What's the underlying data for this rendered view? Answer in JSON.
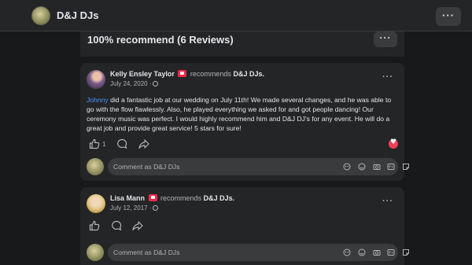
{
  "topbar": {
    "page_name": "D&J DJs",
    "more_label": "···"
  },
  "header": {
    "title": "100% recommend (6 Reviews)",
    "more_label": "···"
  },
  "reviews": [
    {
      "author": "Kelly Ensley Taylor",
      "action": "recommends",
      "page": "D&J DJs.",
      "date": "July 24, 2020 ·",
      "mention": "Johnny",
      "text": " did a fantastic job at our wedding on July 11th! We made several changes, and he was able to go with the flow flawlessly. Also, he played everything we asked for and got people dancing! Our ceremony music was perfect. I would highly recommend him and D&J DJ's for any event. He will do a great job and provide great service! 5 stars for sure!",
      "like_count": "1",
      "more_label": "···",
      "comment_placeholder": "Comment as D&J DJs"
    },
    {
      "author": "Lisa Mann",
      "action": "recommends",
      "page": "D&J DJs.",
      "date": "July 12, 2017 ·",
      "more_label": "···",
      "comment_placeholder": "Comment as D&J DJs"
    }
  ],
  "colors": {
    "background": "#18191a",
    "card": "#242526",
    "mention": "#4599ff",
    "recommend_badge": "#f02849",
    "heart": "#f33e58"
  },
  "icons": [
    "like-icon",
    "comment-icon",
    "share-icon",
    "heart-reaction-icon",
    "emoji-icon",
    "camera-icon",
    "gif-icon",
    "sticker-icon"
  ]
}
